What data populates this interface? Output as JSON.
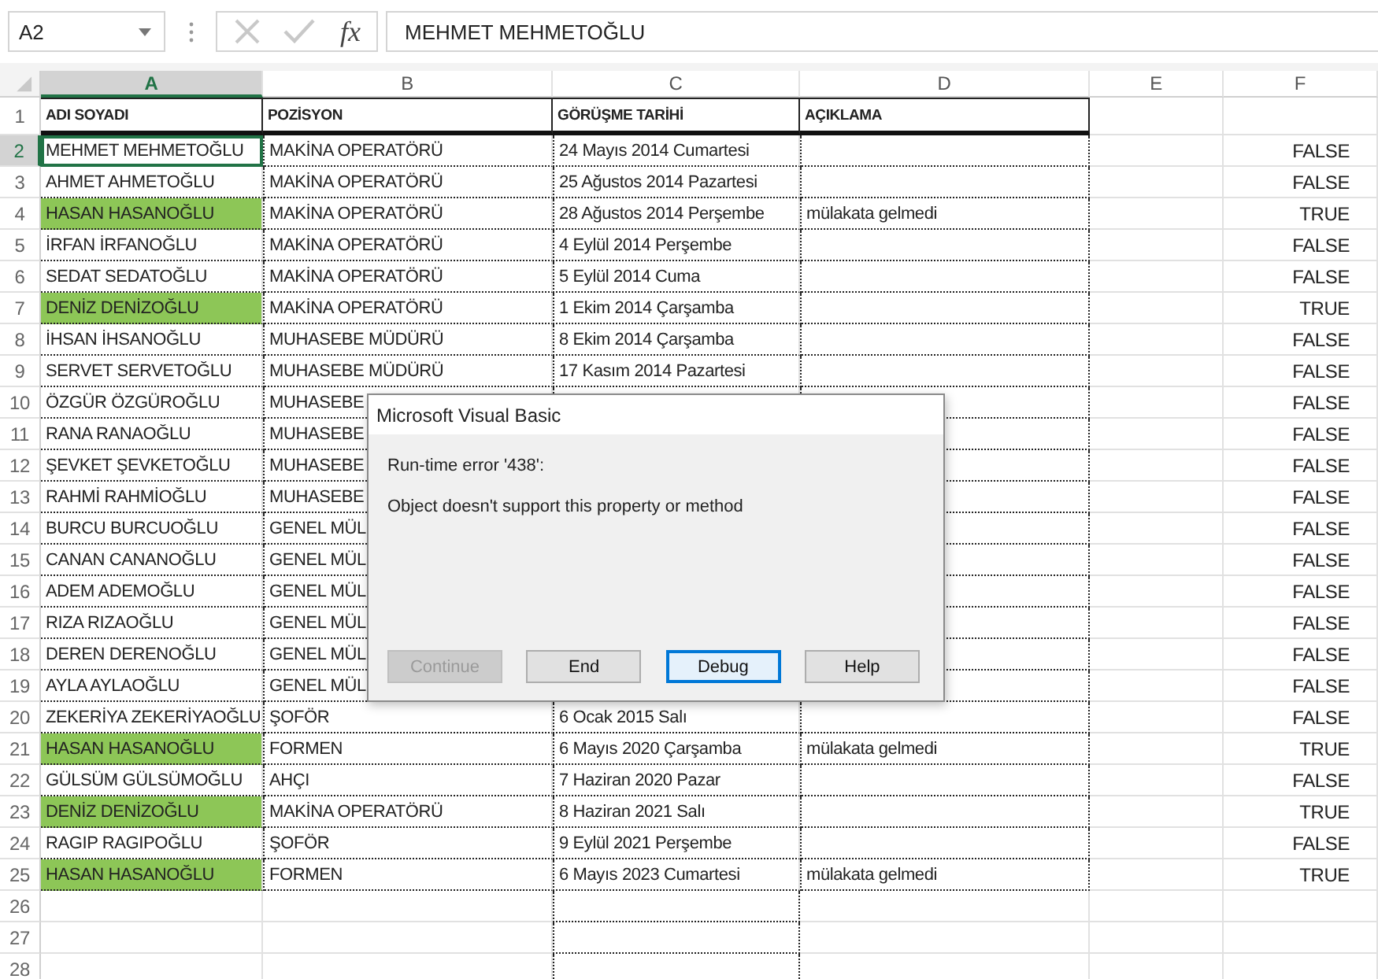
{
  "name_box": {
    "value": "A2"
  },
  "function_button": "fx",
  "formula_bar": {
    "value": "MEHMET MEHMETOĞLU"
  },
  "columns": [
    {
      "label": "A",
      "selected": true
    },
    {
      "label": "B",
      "selected": false
    },
    {
      "label": "C",
      "selected": false
    },
    {
      "label": "D",
      "selected": false
    },
    {
      "label": "E",
      "selected": false
    },
    {
      "label": "F",
      "selected": false
    }
  ],
  "header_row": {
    "number": "1",
    "cells": [
      "ADI SOYADI",
      "POZİSYON",
      "GÖRÜŞME TARİHİ",
      "AÇIKLAMA"
    ]
  },
  "rows": [
    {
      "number": "2",
      "selected": true,
      "highlighted": false,
      "name": "MEHMET MEHMETOĞLU",
      "position": "MAKİNA OPERATÖRÜ",
      "date": "24 Mayıs 2014 Cumartesi",
      "column_f": "FALSE"
    },
    {
      "number": "3",
      "selected": false,
      "highlighted": false,
      "name": "AHMET AHMETOĞLU",
      "position": "MAKİNA OPERATÖRÜ",
      "date": "25 Ağustos 2014 Pazartesi",
      "column_f": "FALSE"
    },
    {
      "number": "4",
      "selected": false,
      "highlighted": true,
      "name": "HASAN HASANOĞLU",
      "position": "MAKİNA OPERATÖRÜ",
      "date": "28 Ağustos 2014 Perşembe",
      "note": "mülakata gelmedi",
      "column_f": "TRUE"
    },
    {
      "number": "5",
      "selected": false,
      "highlighted": false,
      "name": "İRFAN İRFANOĞLU",
      "position": "MAKİNA OPERATÖRÜ",
      "date": "4 Eylül 2014 Perşembe",
      "column_f": "FALSE"
    },
    {
      "number": "6",
      "selected": false,
      "highlighted": false,
      "name": "SEDAT SEDATOĞLU",
      "position": "MAKİNA OPERATÖRÜ",
      "date": "5 Eylül 2014 Cuma",
      "column_f": "FALSE"
    },
    {
      "number": "7",
      "selected": false,
      "highlighted": true,
      "name": "DENİZ DENİZOĞLU",
      "position": "MAKİNA OPERATÖRÜ",
      "date": "1 Ekim 2014 Çarşamba",
      "column_f": "TRUE"
    },
    {
      "number": "8",
      "selected": false,
      "highlighted": false,
      "name": "İHSAN İHSANOĞLU",
      "position": "MUHASEBE MÜDÜRÜ",
      "date": "8 Ekim 2014 Çarşamba",
      "column_f": "FALSE"
    },
    {
      "number": "9",
      "selected": false,
      "highlighted": false,
      "name": "SERVET SERVETOĞLU",
      "position": "MUHASEBE MÜDÜRÜ",
      "date": "17 Kasım 2014 Pazartesi",
      "column_f": "FALSE"
    },
    {
      "number": "10",
      "selected": false,
      "highlighted": false,
      "name": "ÖZGÜR ÖZGÜROĞLU",
      "position": "MUHASEBE",
      "column_f": "FALSE"
    },
    {
      "number": "11",
      "selected": false,
      "highlighted": false,
      "name": "RANA RANAOĞLU",
      "position": "MUHASEBE",
      "column_f": "FALSE"
    },
    {
      "number": "12",
      "selected": false,
      "highlighted": false,
      "name": "ŞEVKET ŞEVKETOĞLU",
      "position": "MUHASEBE",
      "column_f": "FALSE"
    },
    {
      "number": "13",
      "selected": false,
      "highlighted": false,
      "name": "RAHMİ RAHMİOĞLU",
      "position": "MUHASEBE",
      "column_f": "FALSE"
    },
    {
      "number": "14",
      "selected": false,
      "highlighted": false,
      "name": "BURCU BURCUOĞLU",
      "position": "GENEL MÜL",
      "column_f": "FALSE"
    },
    {
      "number": "15",
      "selected": false,
      "highlighted": false,
      "name": "CANAN CANANOĞLU",
      "position": "GENEL MÜL",
      "column_f": "FALSE"
    },
    {
      "number": "16",
      "selected": false,
      "highlighted": false,
      "name": "ADEM ADEMOĞLU",
      "position": "GENEL MÜL",
      "column_f": "FALSE"
    },
    {
      "number": "17",
      "selected": false,
      "highlighted": false,
      "name": "RIZA RIZAOĞLU",
      "position": "GENEL MÜL",
      "column_f": "FALSE"
    },
    {
      "number": "18",
      "selected": false,
      "highlighted": false,
      "name": "DEREN DERENOĞLU",
      "position": "GENEL MÜL",
      "column_f": "FALSE"
    },
    {
      "number": "19",
      "selected": false,
      "highlighted": false,
      "name": "AYLA AYLAOĞLU",
      "position": "GENEL MÜL",
      "column_f": "FALSE"
    },
    {
      "number": "20",
      "selected": false,
      "highlighted": false,
      "name": "ZEKERİYA ZEKERİYAOĞLU",
      "position": "ŞOFÖR",
      "date": "6 Ocak 2015 Salı",
      "column_f": "FALSE"
    },
    {
      "number": "21",
      "selected": false,
      "highlighted": true,
      "name": "HASAN HASANOĞLU",
      "position": "FORMEN",
      "date": "6 Mayıs 2020 Çarşamba",
      "note": "mülakata gelmedi",
      "column_f": "TRUE"
    },
    {
      "number": "22",
      "selected": false,
      "highlighted": false,
      "name": "GÜLSÜM GÜLSÜMOĞLU",
      "position": "AHÇI",
      "date": "7 Haziran 2020 Pazar",
      "column_f": "FALSE"
    },
    {
      "number": "23",
      "selected": false,
      "highlighted": true,
      "name": "DENİZ DENİZOĞLU",
      "position": "MAKİNA OPERATÖRÜ",
      "date": "8 Haziran 2021 Salı",
      "column_f": "TRUE"
    },
    {
      "number": "24",
      "selected": false,
      "highlighted": false,
      "name": "RAGIP RAGIPOĞLU",
      "position": "ŞOFÖR",
      "date": "9 Eylül 2021 Perşembe",
      "column_f": "FALSE"
    },
    {
      "number": "25",
      "selected": false,
      "highlighted": true,
      "name": "HASAN HASANOĞLU",
      "position": "FORMEN",
      "date": "6 Mayıs 2023 Cumartesi",
      "note": "mülakata gelmedi",
      "column_f": "TRUE"
    },
    {
      "number": "26",
      "selected": false,
      "highlighted": false
    },
    {
      "number": "27",
      "selected": false,
      "highlighted": false
    },
    {
      "number": "28",
      "selected": false,
      "highlighted": false
    }
  ],
  "dialog": {
    "title": "Microsoft Visual Basic",
    "error": "Run-time error '438':",
    "message": "Object doesn't support this property or method",
    "buttons": [
      {
        "label": "Continue",
        "disabled": true,
        "focused": false
      },
      {
        "label": "End",
        "disabled": false,
        "focused": false
      },
      {
        "label": "Debug",
        "disabled": false,
        "focused": true
      },
      {
        "label": "Help",
        "disabled": false,
        "focused": false
      }
    ]
  }
}
